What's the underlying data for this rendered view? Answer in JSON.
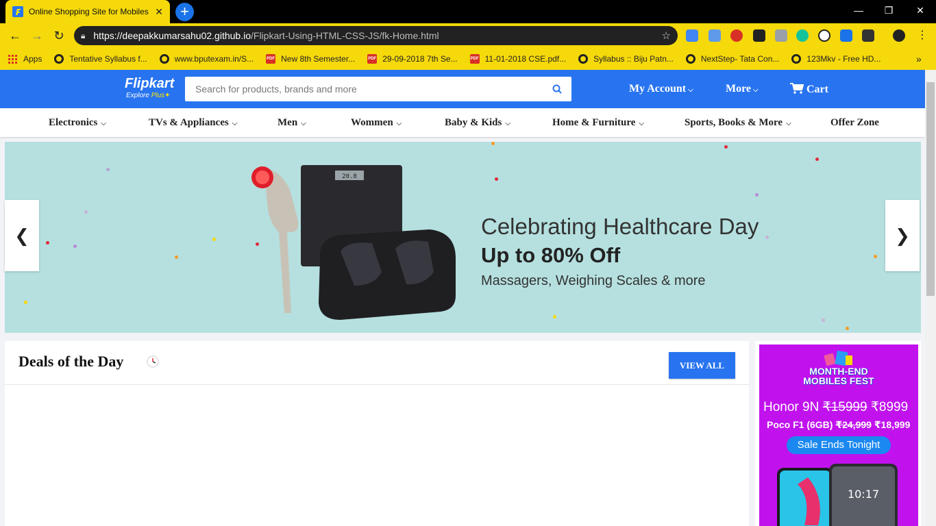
{
  "browser": {
    "tab_title": "Online Shopping Site for Mobiles",
    "tab_close": "✕",
    "new_tab": "+",
    "url_host": "https://deepakkumarsahu02.github.io",
    "url_path": "/Flipkart-Using-HTML-CSS-JS/fk-Home.html",
    "bookmarks": [
      {
        "label": "Apps",
        "icon": "apps-grid-icon"
      },
      {
        "label": "Tentative Syllabus f...",
        "icon": "globe-icon"
      },
      {
        "label": "www.bputexam.in/S...",
        "icon": "globe-icon"
      },
      {
        "label": "New 8th Semester...",
        "icon": "pdf-icon"
      },
      {
        "label": "29-09-2018 7th Se...",
        "icon": "pdf-icon"
      },
      {
        "label": "11-01-2018 CSE.pdf...",
        "icon": "pdf-icon"
      },
      {
        "label": "Syllabus :: Biju Patn...",
        "icon": "globe-icon"
      },
      {
        "label": "NextStep- Tata Con...",
        "icon": "globe-icon"
      },
      {
        "label": "123Mkv - Free HD...",
        "icon": "globe-icon"
      }
    ],
    "bookmarks_overflow": "»"
  },
  "header": {
    "logo": "Flipkart",
    "logo_sub_a": "Explore",
    "logo_sub_b": "Plus",
    "search_placeholder": "Search for products, brands and more",
    "my_account": "My Account",
    "more": "More",
    "cart": "Cart",
    "brand_color": "#2874f0"
  },
  "categories": [
    "Electronics",
    "TVs & Appliances",
    "Men",
    "Wommen",
    "Baby & Kids",
    "Home & Furniture",
    "Sports, Books & More",
    "Offer Zone"
  ],
  "banner": {
    "title": "Celebrating Healthcare Day",
    "offer": "Up to 80% Off",
    "subtitle": "Massagers, Weighing Scales & more",
    "prev": "❮",
    "next": "❯",
    "scale_readout": "20.8"
  },
  "deals": {
    "title": "Deals of the Day",
    "view_all": "VIEW ALL"
  },
  "ad": {
    "fest_line1": "MONTH-END",
    "fest_line2": "MOBILES FEST",
    "p1_name": "Honor 9N",
    "p1_old": "₹15999",
    "p1_new": "₹8999",
    "p2_name": "Poco F1 (6GB)",
    "p2_old": "₹24,999",
    "p2_new": "₹18,999",
    "cta": "Sale Ends Tonight",
    "phone_time": "10:17"
  }
}
